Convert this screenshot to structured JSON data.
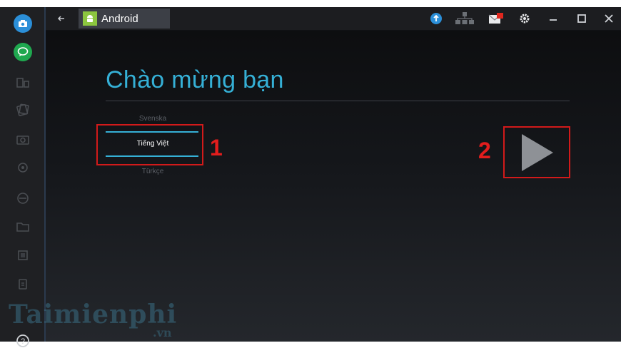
{
  "window": {
    "tab_title": "Android",
    "controls": [
      "minimize-icon",
      "maximize-icon",
      "close-icon"
    ]
  },
  "topbar_icons": [
    "back-arrow-icon",
    "android-icon",
    "upload-icon",
    "network-icon",
    "notification-icon",
    "gear-icon"
  ],
  "sidebar_icons": [
    "camera-icon",
    "chat-icon",
    "apps-icon",
    "cards-icon",
    "camera-outline-icon",
    "location-icon",
    "no-entry-icon",
    "folder-icon",
    "copy-icon",
    "clipboard-icon",
    "help-icon"
  ],
  "setup": {
    "welcome_title": "Chào mừng bạn",
    "languages": {
      "above": "Svenska",
      "selected": "Tiếng Việt",
      "below": "Türkçe"
    }
  },
  "annotations": {
    "step1": "1",
    "step2": "2"
  },
  "watermark": {
    "main": "Taimienphi",
    "sub": ".vn"
  },
  "colors": {
    "accent": "#35b0d6",
    "annotation_red": "#d21a1a",
    "tab_bg": "#3c3f46",
    "sidebar_active": "#1fa84f",
    "sidebar_camera": "#2b8fd8"
  }
}
